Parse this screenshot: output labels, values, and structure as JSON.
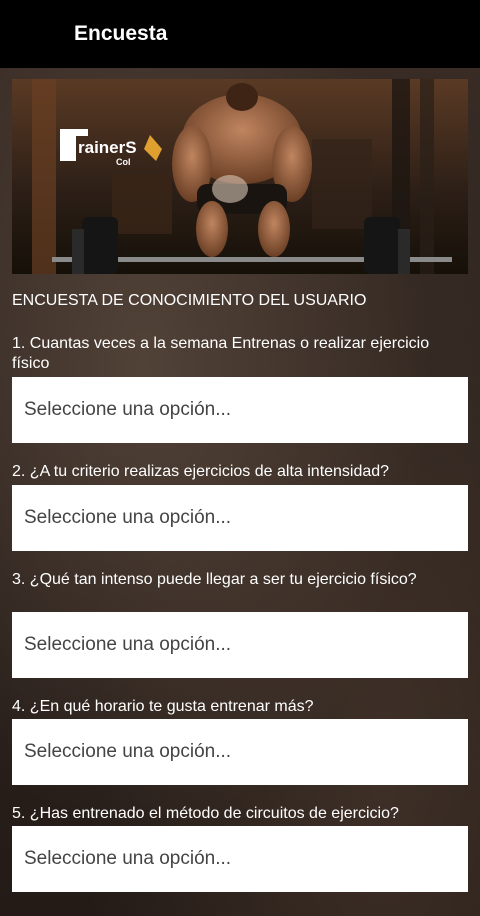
{
  "appbar": {
    "title": "Encuesta"
  },
  "banner": {
    "logo_text": "rainerS",
    "logo_sub": "Col"
  },
  "survey": {
    "heading": "ENCUESTA DE CONOCIMIENTO DEL USUARIO",
    "questions": [
      {
        "text": "1. Cuantas veces a la semana Entrenas o realizar ejercicio físico",
        "selected": "Seleccione una opción..."
      },
      {
        "text": "2. ¿A tu criterio realizas ejercicios de alta intensidad?",
        "selected": "Seleccione una opción..."
      },
      {
        "text": "3. ¿Qué tan intenso puede llegar a ser tu ejercicio físico?",
        "selected": "Seleccione una opción..."
      },
      {
        "text": "4. ¿En qué horario te gusta entrenar más?",
        "selected": "Seleccione una opción..."
      },
      {
        "text": "5. ¿Has entrenado el método de circuitos de ejercicio?",
        "selected": "Seleccione una opción..."
      }
    ]
  }
}
